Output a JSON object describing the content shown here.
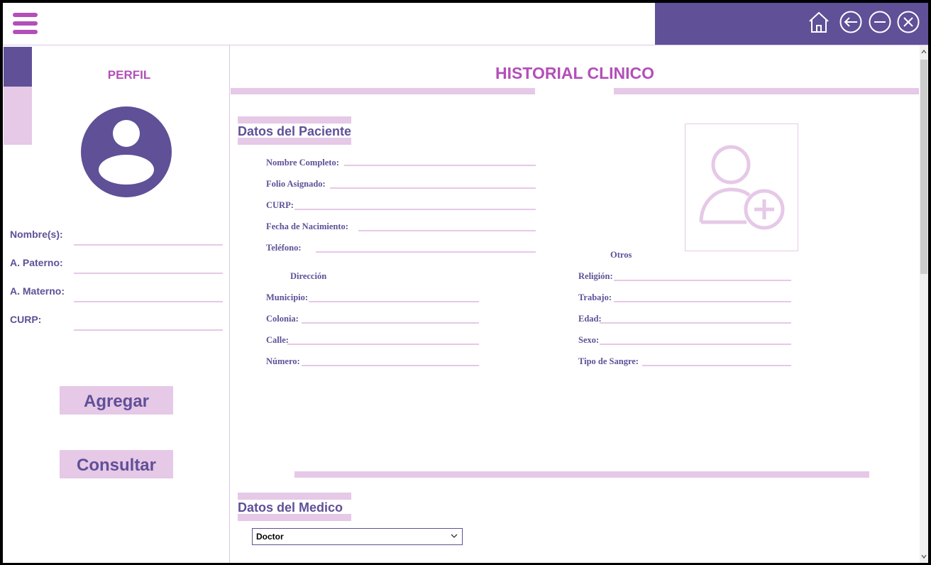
{
  "header": {
    "icons": [
      "menu-icon",
      "home-icon",
      "back-arrow-icon",
      "minimize-icon",
      "close-icon"
    ],
    "colors": {
      "purple": "#5f5097",
      "magenta": "#b34fb8",
      "pink": "#e6c8e7"
    }
  },
  "sidebar": {
    "title": "PERFIL",
    "fields": [
      {
        "label": "Nombre(s):"
      },
      {
        "label": "A. Paterno:"
      },
      {
        "label": "A. Materno:"
      },
      {
        "label": "CURP:"
      }
    ],
    "buttons": {
      "add": "Agregar",
      "search": "Consultar"
    }
  },
  "main": {
    "title": "HISTORIAL CLINICO",
    "patient": {
      "section_title": "Datos del Paciente",
      "fields": [
        {
          "label": "Nombre Completo:"
        },
        {
          "label": "Folio Asignado:"
        },
        {
          "label": "CURP:"
        },
        {
          "label": "Fecha de Nacimiento:"
        },
        {
          "label": "Teléfono:"
        }
      ],
      "address_title": "Dirección",
      "address_fields": [
        {
          "label": "Municipio:"
        },
        {
          "label": "Colonia:"
        },
        {
          "label": "Calle:"
        },
        {
          "label": "Número:"
        }
      ],
      "other_title": "Otros",
      "other_fields": [
        {
          "label": "Religión:"
        },
        {
          "label": "Trabajo:"
        },
        {
          "label": "Edad:"
        },
        {
          "label": "Sexo:"
        },
        {
          "label": "Tipo de Sangre:"
        }
      ]
    },
    "doctor": {
      "section_title": "Datos del Medico",
      "select_value": "Doctor"
    }
  }
}
